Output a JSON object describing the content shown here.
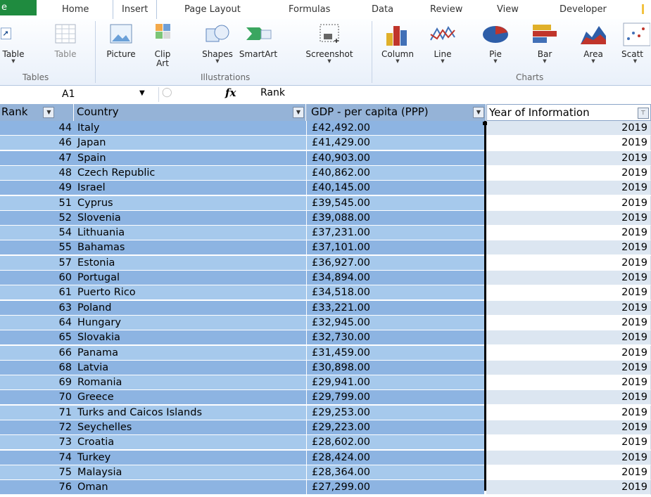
{
  "tabs": {
    "file": "e",
    "home": "Home",
    "insert": "Insert",
    "page_layout": "Page Layout",
    "formulas": "Formulas",
    "data": "Data",
    "review": "Review",
    "view": "View",
    "developer": "Developer"
  },
  "ribbon": {
    "tables_group": "Tables",
    "illustrations_group": "Illustrations",
    "charts_group": "Charts",
    "buttons": {
      "pivot_table": "Table",
      "table": "Table",
      "picture": "Picture",
      "clip_art": "Clip Art",
      "shapes": "Shapes",
      "smartart": "SmartArt",
      "screenshot": "Screenshot",
      "column": "Column",
      "line": "Line",
      "pie": "Pie",
      "bar": "Bar",
      "area": "Area",
      "scatter": "Scatt"
    }
  },
  "formula_bar": {
    "name_box": "A1",
    "fx_symbol": "fx",
    "value": "Rank"
  },
  "table": {
    "headers": {
      "rank": "Rank",
      "country": "Country",
      "gdp": "GDP - per capita (PPP)",
      "year": "Year of Information"
    },
    "rows": [
      {
        "rank": "44",
        "country": "Italy",
        "gdp": "£42,492.00",
        "year": "2019"
      },
      {
        "rank": "46",
        "country": "Japan",
        "gdp": "£41,429.00",
        "year": "2019"
      },
      {
        "rank": "47",
        "country": "Spain",
        "gdp": "£40,903.00",
        "year": "2019"
      },
      {
        "rank": "48",
        "country": "Czech Republic",
        "gdp": "£40,862.00",
        "year": "2019"
      },
      {
        "rank": "49",
        "country": "Israel",
        "gdp": "£40,145.00",
        "year": "2019"
      },
      {
        "rank": "51",
        "country": "Cyprus",
        "gdp": "£39,545.00",
        "year": "2019"
      },
      {
        "rank": "52",
        "country": "Slovenia",
        "gdp": "£39,088.00",
        "year": "2019"
      },
      {
        "rank": "54",
        "country": "Lithuania",
        "gdp": "£37,231.00",
        "year": "2019"
      },
      {
        "rank": "55",
        "country": "Bahamas",
        "gdp": "£37,101.00",
        "year": "2019"
      },
      {
        "rank": "57",
        "country": "Estonia",
        "gdp": "£36,927.00",
        "year": "2019"
      },
      {
        "rank": "60",
        "country": "Portugal",
        "gdp": "£34,894.00",
        "year": "2019"
      },
      {
        "rank": "61",
        "country": "Puerto Rico",
        "gdp": "£34,518.00",
        "year": "2019"
      },
      {
        "rank": "63",
        "country": "Poland",
        "gdp": "£33,221.00",
        "year": "2019"
      },
      {
        "rank": "64",
        "country": "Hungary",
        "gdp": "£32,945.00",
        "year": "2019"
      },
      {
        "rank": "65",
        "country": "Slovakia",
        "gdp": "£32,730.00",
        "year": "2019"
      },
      {
        "rank": "66",
        "country": "Panama",
        "gdp": "£31,459.00",
        "year": "2019"
      },
      {
        "rank": "68",
        "country": "Latvia",
        "gdp": "£30,898.00",
        "year": "2019"
      },
      {
        "rank": "69",
        "country": "Romania",
        "gdp": "£29,941.00",
        "year": "2019"
      },
      {
        "rank": "70",
        "country": "Greece",
        "gdp": "£29,799.00",
        "year": "2019"
      },
      {
        "rank": "71",
        "country": "Turks and Caicos Islands",
        "gdp": "£29,253.00",
        "year": "2019"
      },
      {
        "rank": "72",
        "country": "Seychelles",
        "gdp": "£29,223.00",
        "year": "2019"
      },
      {
        "rank": "73",
        "country": "Croatia",
        "gdp": "£28,602.00",
        "year": "2019"
      },
      {
        "rank": "74",
        "country": "Turkey",
        "gdp": "£28,424.00",
        "year": "2019"
      },
      {
        "rank": "75",
        "country": "Malaysia",
        "gdp": "£28,364.00",
        "year": "2019"
      },
      {
        "rank": "76",
        "country": "Oman",
        "gdp": "£27,299.00",
        "year": "2019"
      }
    ]
  },
  "colors": {
    "header_fill": "#95b3d7",
    "row_blue_dark": "#8db4e2",
    "row_blue_light": "#a6c9ec",
    "row_year_alt": "#dce6f1",
    "file_tab": "#1f8b3f"
  }
}
